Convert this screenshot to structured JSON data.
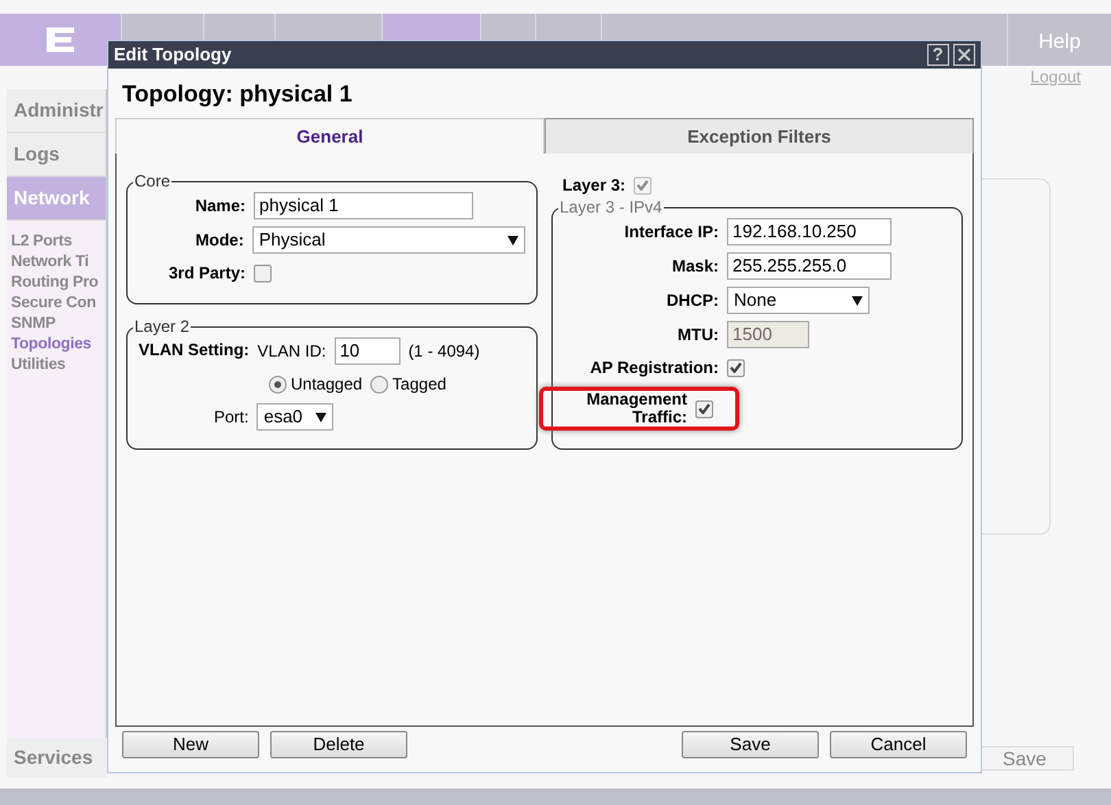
{
  "header": {
    "nav": [
      {
        "selected": false
      },
      {
        "selected": false
      },
      {
        "selected": false
      },
      {
        "selected": true
      },
      {
        "selected": false
      },
      {
        "selected": false
      },
      {
        "selected": false
      }
    ],
    "help": "Help",
    "logout": "Logout"
  },
  "sidebar": {
    "items": [
      {
        "label": "Administr",
        "kind": "section",
        "selected": false
      },
      {
        "label": "Logs",
        "kind": "section",
        "selected": false
      },
      {
        "label": "Network",
        "kind": "section",
        "selected": true
      },
      {
        "label": "L2 Ports",
        "kind": "link",
        "selected": false
      },
      {
        "label": "Network Ti",
        "kind": "link",
        "selected": false
      },
      {
        "label": "Routing Pro",
        "kind": "link",
        "selected": false
      },
      {
        "label": "Secure Con",
        "kind": "link",
        "selected": false
      },
      {
        "label": "SNMP",
        "kind": "link",
        "selected": false
      },
      {
        "label": "Topologies",
        "kind": "link",
        "selected": true
      },
      {
        "label": "Utilities",
        "kind": "link",
        "selected": false
      }
    ],
    "bottom": "Services"
  },
  "background": {
    "save_button": "Save"
  },
  "dialog": {
    "title": "Edit Topology",
    "help_button": "?",
    "heading": "Topology: physical 1",
    "tabs": [
      {
        "label": "General",
        "selected": true
      },
      {
        "label": "Exception Filters",
        "selected": false
      }
    ],
    "core": {
      "legend": "Core",
      "name_label": "Name:",
      "name_value": "physical 1",
      "mode_label": "Mode:",
      "mode_value": "Physical",
      "third_party_label": "3rd Party:",
      "third_party_checked": false
    },
    "layer2": {
      "legend": "Layer 2",
      "vlan_setting_label": "VLAN Setting:",
      "vlan_id_label": "VLAN ID:",
      "vlan_id_value": "10",
      "range": "(1 - 4094)",
      "tagging": [
        {
          "label": "Untagged",
          "selected": true
        },
        {
          "label": "Tagged",
          "selected": false
        }
      ],
      "port_label": "Port:",
      "port_value": "esa0"
    },
    "layer3": {
      "label": "Layer 3:",
      "checked": true,
      "disabled": true
    },
    "ipv4": {
      "legend": "Layer 3 - IPv4",
      "fields": [
        {
          "kind": "text",
          "label": "Interface IP:",
          "value": "192.168.10.250"
        },
        {
          "kind": "text",
          "label": "Mask:",
          "value": "255.255.255.0"
        },
        {
          "kind": "select",
          "label": "DHCP:",
          "value": "None"
        },
        {
          "kind": "readonly",
          "label": "MTU:",
          "value": "1500"
        },
        {
          "kind": "checkbox",
          "label": "AP Registration:",
          "checked": true,
          "highlighted": false
        },
        {
          "kind": "checkbox",
          "label": "Management Traffic:",
          "checked": true,
          "highlighted": true
        }
      ]
    },
    "left_buttons": [
      "New",
      "Delete"
    ],
    "right_buttons": [
      "Save",
      "Cancel"
    ]
  }
}
